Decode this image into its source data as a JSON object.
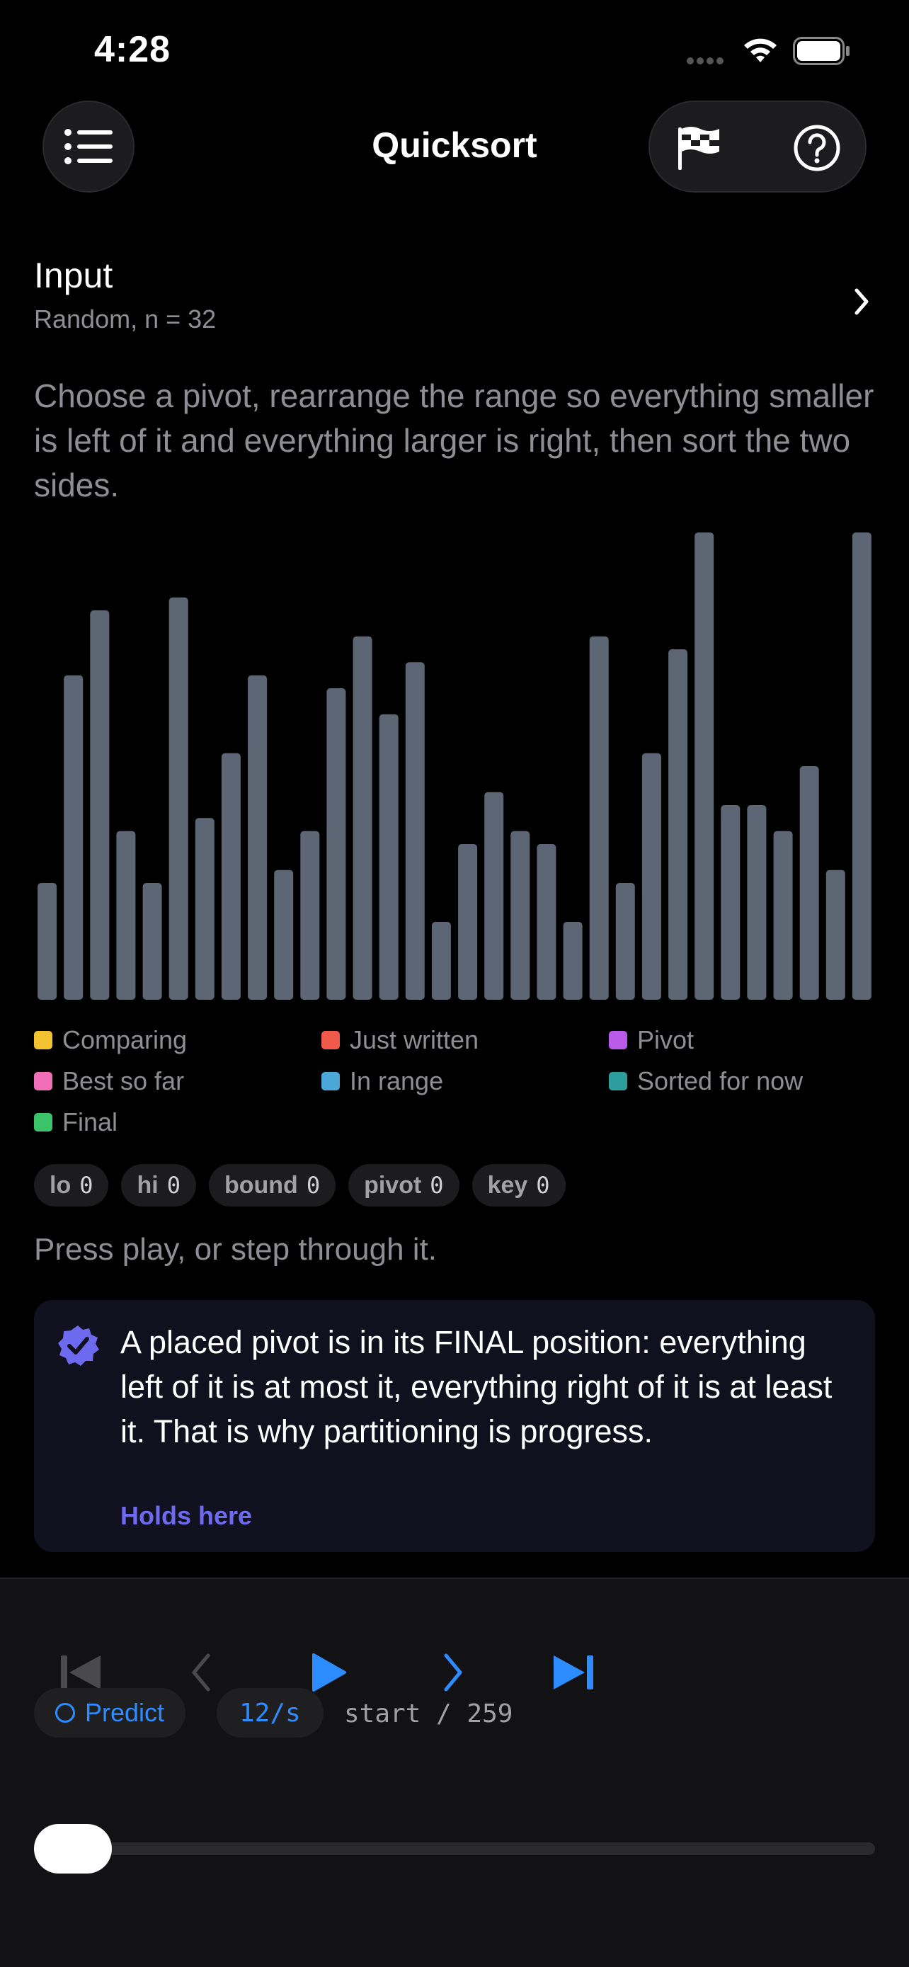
{
  "status_bar": {
    "time": "4:28"
  },
  "nav": {
    "title": "Quicksort",
    "menu_icon": "list-icon",
    "flag_icon": "checkered-flag-icon",
    "help_icon": "question-circle-icon"
  },
  "input": {
    "title": "Input",
    "subtitle": "Random, n = 32"
  },
  "description": "Choose a pivot, rearrange the range so everything smaller is left of it and everything larger is right, then sort the two sides.",
  "chart_data": {
    "type": "bar",
    "values": [
      9,
      25,
      30,
      13,
      9,
      31,
      14,
      19,
      25,
      10,
      13,
      24,
      28,
      22,
      26,
      6,
      12,
      16,
      13,
      12,
      6,
      28,
      9,
      19,
      27,
      36,
      15,
      15,
      13,
      18,
      10,
      36
    ],
    "ylim": [
      0,
      36
    ],
    "bar_color": "#5d6675",
    "title": "",
    "xlabel": "",
    "ylabel": ""
  },
  "legend": [
    {
      "label": "Comparing",
      "color": "#f2c230",
      "icon": "square"
    },
    {
      "label": "Just written",
      "color": "#ef5a4a",
      "icon": "square-check"
    },
    {
      "label": "Pivot",
      "color": "#b95ae8",
      "icon": "square"
    },
    {
      "label": "Best so far",
      "color": "#f06fb6",
      "icon": "square"
    },
    {
      "label": "In range",
      "color": "#4aa7d8",
      "icon": "square"
    },
    {
      "label": "Sorted for now",
      "color": "#2d9d9d",
      "icon": "square-lock"
    },
    {
      "label": "Final",
      "color": "#3cc46a",
      "icon": "square"
    }
  ],
  "vars": [
    {
      "name": "lo",
      "value": "0"
    },
    {
      "name": "hi",
      "value": "0"
    },
    {
      "name": "bound",
      "value": "0"
    },
    {
      "name": "pivot",
      "value": "0"
    },
    {
      "name": "key",
      "value": "0"
    }
  ],
  "hint": "Press play, or step through it.",
  "invariant": {
    "icon": "verified-badge-icon",
    "text": "A placed pivot is in its FINAL position: everything left of it is at most it, everything right of it is at least it. That is why partitioning is progress.",
    "status": "Holds here",
    "accent": "#6e6af0"
  },
  "controls": {
    "accent": "#2d8cff",
    "predict_label": "Predict",
    "speed": "12/s",
    "step_counter": "start / 259",
    "progress": 0
  }
}
